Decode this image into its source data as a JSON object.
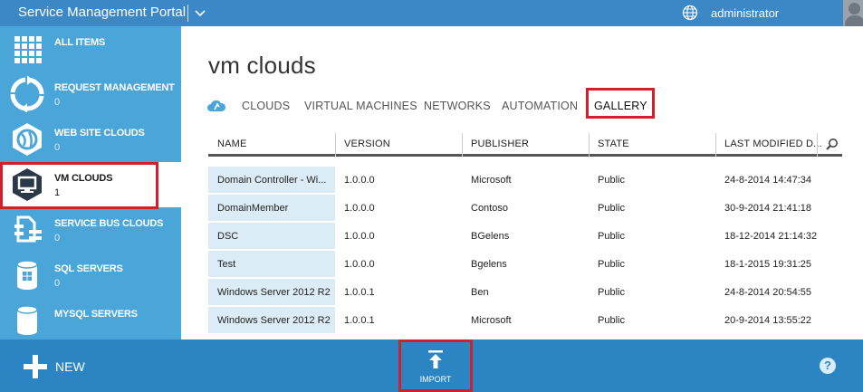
{
  "topbar": {
    "title": "Service Management Portal",
    "user": "administrator",
    "chevron_icon": "chevron-down-icon",
    "globe_icon": "globe-icon"
  },
  "sidebar": {
    "items": [
      {
        "label": "ALL ITEMS",
        "count": "",
        "icon": "grid-icon"
      },
      {
        "label": "REQUEST MANAGEMENT",
        "count": "0",
        "icon": "cycle-arrows-icon"
      },
      {
        "label": "WEB SITE CLOUDS",
        "count": "0",
        "icon": "globe-hex-icon"
      },
      {
        "label": "VM CLOUDS",
        "count": "1",
        "icon": "monitor-hex-icon"
      },
      {
        "label": "SERVICE BUS CLOUDS",
        "count": "0",
        "icon": "service-bus-icon"
      },
      {
        "label": "SQL SERVERS",
        "count": "0",
        "icon": "database-windows-icon"
      },
      {
        "label": "MYSQL SERVERS",
        "count": "",
        "icon": "database-icon"
      }
    ]
  },
  "main": {
    "title": "vm clouds",
    "tabs": [
      "CLOUDS",
      "VIRTUAL MACHINES",
      "NETWORKS",
      "AUTOMATION",
      "GALLERY"
    ],
    "active_tab": "GALLERY",
    "columns": [
      "NAME",
      "VERSION",
      "PUBLISHER",
      "STATE",
      "LAST MODIFIED D..."
    ],
    "rows": [
      {
        "name": "Domain Controller - Wi...",
        "version": "1.0.0.0",
        "publisher": "Microsoft",
        "state": "Public",
        "modified": "24-8-2014 14:47:34"
      },
      {
        "name": "DomainMember",
        "version": "1.0.0.0",
        "publisher": "Contoso",
        "state": "Public",
        "modified": "30-9-2014 21:41:18"
      },
      {
        "name": "DSC",
        "version": "1.0.0.0",
        "publisher": "BGelens",
        "state": "Public",
        "modified": "18-12-2014 21:14:32"
      },
      {
        "name": "Test",
        "version": "1.0.0.0",
        "publisher": "Bgelens",
        "state": "Public",
        "modified": "18-1-2015 19:31:25"
      },
      {
        "name": "Windows Server 2012 R2",
        "version": "1.0.0.1",
        "publisher": "Ben",
        "state": "Public",
        "modified": "24-8-2014 20:54:55"
      },
      {
        "name": "Windows Server 2012 R2",
        "version": "1.0.0.1",
        "publisher": "Microsoft",
        "state": "Public",
        "modified": "20-9-2014 13:55:22"
      }
    ]
  },
  "bottombar": {
    "new_label": "NEW",
    "import_label": "IMPORT",
    "help_label": "?"
  },
  "colors": {
    "topbar": "#3c88c6",
    "sidebar": "#4aa6d9",
    "bottombar": "#2b85c3",
    "highlight": "#d31f2b",
    "name_cell": "#dcecf7"
  }
}
